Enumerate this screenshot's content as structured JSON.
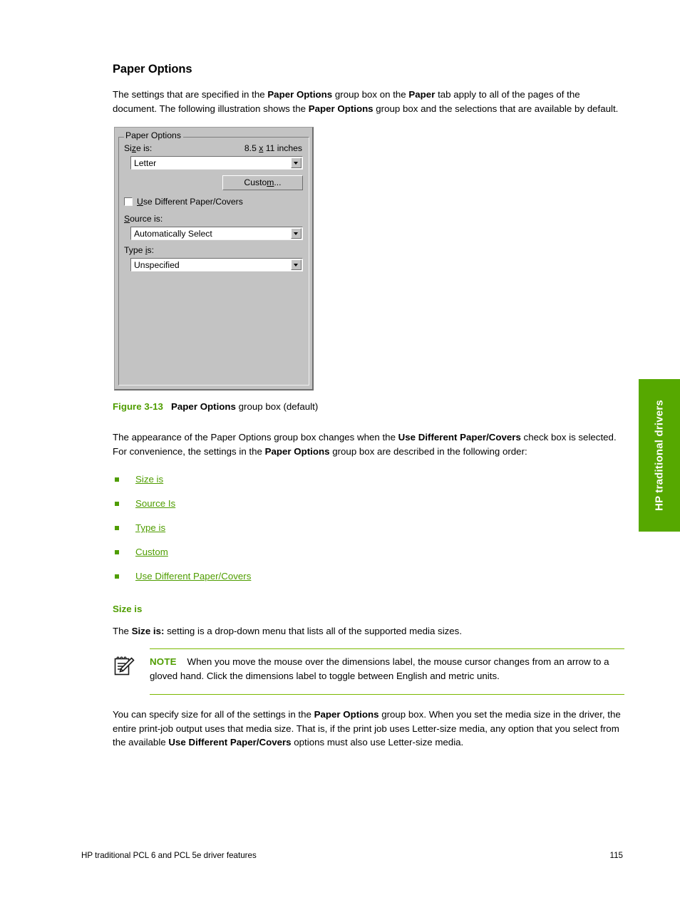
{
  "section": {
    "title": "Paper Options",
    "intro_segments": [
      {
        "t": "The settings that are specified in the ",
        "b": false
      },
      {
        "t": "Paper Options",
        "b": true
      },
      {
        "t": " group box on the ",
        "b": false
      },
      {
        "t": "Paper",
        "b": true
      },
      {
        "t": " tab apply to all of the pages of the document. The following illustration shows the ",
        "b": false
      },
      {
        "t": "Paper Options",
        "b": true
      },
      {
        "t": " group box and the selections that are available by default.",
        "b": false
      }
    ]
  },
  "dialog": {
    "group_title": "Paper Options",
    "size_label": "Size is:",
    "size_label_access_key": "z",
    "dimensions_label": "8.5 x 11 inches",
    "dimensions_access_key": "x",
    "size_value": "Letter",
    "custom_button": "Custom...",
    "custom_access_key": "m",
    "checkbox_label": "Use Different Paper/Covers",
    "checkbox_access_key": "U",
    "checkbox_checked": false,
    "source_label": "Source is:",
    "source_access_key": "S",
    "source_value": "Automatically Select",
    "type_label": "Type is:",
    "type_access_key": "i",
    "type_value": "Unspecified",
    "dropdown_icon": "chevron-down-icon"
  },
  "figure": {
    "number": "Figure 3-13",
    "caption_bold": "Paper Options",
    "caption_rest": " group box (default)"
  },
  "after_figure": {
    "segments": [
      {
        "t": "The appearance of the Paper Options group box changes when the ",
        "b": false
      },
      {
        "t": "Use Different Paper/Covers",
        "b": true
      },
      {
        "t": " check box is selected. For convenience, the settings in the ",
        "b": false
      },
      {
        "t": "Paper Options",
        "b": true
      },
      {
        "t": " group box are described in the following order:",
        "b": false
      }
    ]
  },
  "links": [
    {
      "label": "Size is",
      "bullet": "square-bullet-icon"
    },
    {
      "label": "Source Is",
      "bullet": "square-bullet-icon"
    },
    {
      "label": "Type is",
      "bullet": "square-bullet-icon"
    },
    {
      "label": "Custom",
      "bullet": "square-bullet-icon"
    },
    {
      "label": "Use Different Paper/Covers",
      "bullet": "square-bullet-icon"
    }
  ],
  "subsection": {
    "heading": "Size is",
    "intro_segments": [
      {
        "t": "The ",
        "b": false
      },
      {
        "t": "Size is:",
        "b": true
      },
      {
        "t": " setting is a drop-down menu that lists all of the supported media sizes.",
        "b": false
      }
    ]
  },
  "note": {
    "icon": "note-pencil-icon",
    "keyword": "NOTE",
    "text": "When you move the mouse over the dimensions label, the mouse cursor changes from an arrow to a gloved hand. Click the dimensions label to toggle between English and metric units."
  },
  "closing": {
    "segments": [
      {
        "t": "You can specify size for all of the settings in the ",
        "b": false
      },
      {
        "t": "Paper Options",
        "b": true
      },
      {
        "t": " group box. When you set the media size in the driver, the entire print-job output uses that media size. That is, if the print job uses Letter-size media, any option that you select from the available ",
        "b": false
      },
      {
        "t": "Use Different Paper/Covers",
        "b": true
      },
      {
        "t": " options must also use Letter-size media.",
        "b": false
      }
    ]
  },
  "side_tab": {
    "label": "HP traditional drivers",
    "color": "#56a800"
  },
  "footer": {
    "left": "HP traditional PCL 6 and PCL 5e driver features",
    "page_number": "115"
  },
  "colors": {
    "accent_green": "#4f9d00",
    "rule_green": "#7ab800",
    "tab_green": "#56a800",
    "dialog_face": "#c3c3c3"
  }
}
